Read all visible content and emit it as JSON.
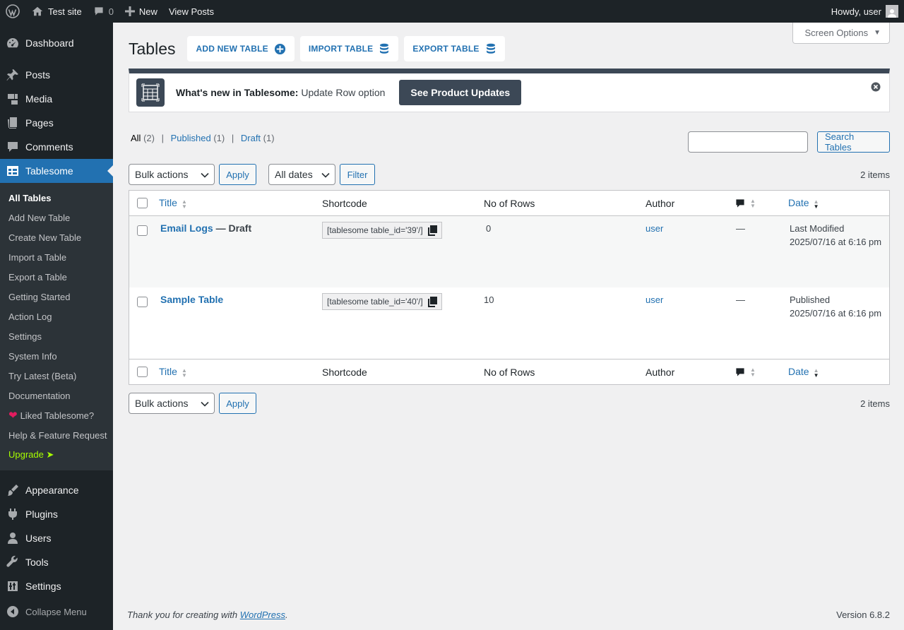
{
  "adminbar": {
    "site_name": "Test site",
    "comments_count": "0",
    "new_label": "New",
    "view_posts": "View Posts",
    "howdy": "Howdy, user"
  },
  "sidebar": {
    "menu_top": [
      {
        "label": "Dashboard",
        "icon": "dashboard-icon"
      },
      {
        "label": "Posts",
        "icon": "pin-icon"
      },
      {
        "label": "Media",
        "icon": "media-icon"
      },
      {
        "label": "Pages",
        "icon": "pages-icon"
      },
      {
        "label": "Comments",
        "icon": "comment-icon"
      },
      {
        "label": "Tablesome",
        "icon": "table-icon"
      }
    ],
    "submenu": [
      "All Tables",
      "Add New Table",
      "Create New Table",
      "Import a Table",
      "Export a Table",
      "Getting Started",
      "Action Log",
      "Settings",
      "System Info",
      "Try Latest (Beta)",
      "Documentation",
      "Liked Tablesome?",
      "Help & Feature Request",
      "Upgrade ➤"
    ],
    "menu_bottom": [
      {
        "label": "Appearance",
        "icon": "brush-icon"
      },
      {
        "label": "Plugins",
        "icon": "plugin-icon"
      },
      {
        "label": "Users",
        "icon": "users-icon"
      },
      {
        "label": "Tools",
        "icon": "wrench-icon"
      },
      {
        "label": "Settings",
        "icon": "settings-icon"
      }
    ],
    "collapse": "Collapse Menu"
  },
  "screen_options": "Screen Options",
  "page": {
    "title": "Tables",
    "buttons": [
      "ADD NEW TABLE",
      "IMPORT TABLE",
      "EXPORT TABLE"
    ]
  },
  "notice": {
    "lead": "What's new in Tablesome:",
    "text": " Update Row option",
    "cta": "See Product Updates"
  },
  "filters": {
    "all": "All",
    "all_count": "(2)",
    "published": "Published",
    "published_count": "(1)",
    "draft": "Draft",
    "draft_count": "(1)",
    "sep": "|"
  },
  "search": {
    "button": "Search Tables"
  },
  "tablenav": {
    "bulk": "Bulk actions",
    "apply": "Apply",
    "dates": "All dates",
    "filter": "Filter",
    "items": "2 items"
  },
  "columns": {
    "title": "Title",
    "shortcode": "Shortcode",
    "rows": "No of Rows",
    "author": "Author",
    "date": "Date"
  },
  "rows": [
    {
      "title": "Email Logs",
      "state": " — Draft",
      "shortcode": "[tablesome table_id='39'/]",
      "rows": "0",
      "author": "user",
      "comments": "—",
      "date_status": "Last Modified",
      "date": "2025/07/16 at 6:16 pm"
    },
    {
      "title": "Sample Table",
      "state": "",
      "shortcode": "[tablesome table_id='40'/]",
      "rows": "10",
      "author": "user",
      "comments": "—",
      "date_status": "Published",
      "date": "2025/07/16 at 6:16 pm"
    }
  ],
  "footer": {
    "thanks_prefix": "Thank you for creating with ",
    "thanks_link": "WordPress",
    "thanks_suffix": ".",
    "version": "Version 6.8.2"
  },
  "colors": {
    "accent": "#2271b1",
    "sidebar_bg": "#1d2327",
    "notice_dark": "#3c4856",
    "upgrade": "#a7ff00",
    "heart": "#e31c5f"
  }
}
